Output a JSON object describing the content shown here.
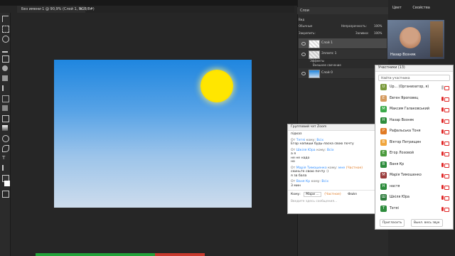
{
  "photoshop": {
    "doc_tab": "Без имени-1 @ 90,9% (Слой 1, RGB/8#)",
    "layers_panel_title": "Слои",
    "blend_mode": "Обычные",
    "opacity_label": "Непрозрачность:",
    "opacity_value": "100%",
    "lock_label": "Закрепить:",
    "fill_label": "Заливка:",
    "fill_value": "100%",
    "layers": [
      {
        "name": "Слой 1"
      },
      {
        "name": "Эллипс 1"
      },
      {
        "name": "Слой 0"
      }
    ],
    "effects_label": "Эффекты",
    "glow_label": "Внешнее свечение",
    "search_kind": "Вид",
    "right_menu": [
      "Цвет",
      "Свойства"
    ]
  },
  "video": {
    "name": "Назар Возняк"
  },
  "chat": {
    "title": "Групповий чат Zoom",
    "top_text": "підказ",
    "messages": [
      {
        "from": "Тетяі",
        "to": "Всіх",
        "text": "Егор напиши будь-ласка свою почту"
      },
      {
        "from": "Шкіля Юра",
        "to": "Всіх",
        "text": "а я\nне не надо\nно"
      },
      {
        "from": "Марія Тимошенко",
        "to": "мне",
        "note": "(Частное)",
        "text": "скиньте свою почту :)\nя за бала"
      },
      {
        "from": "Ваня Кр",
        "to": "Всіх",
        "text": "3 мин"
      }
    ],
    "from_prefix": "От",
    "to_prefix": "кому:",
    "to_label": "Кому:",
    "recipient": "Мари ...",
    "private_note": "(Частное)",
    "file_label": "Файл",
    "input_placeholder": "Введите здесь сообщения..."
  },
  "participants": {
    "title": "Участники (13)",
    "search_placeholder": "Найти участника",
    "list": [
      {
        "initial": "U",
        "name": "Up... (Организатор, я)",
        "color": "#7a9a3c"
      },
      {
        "initial": "Е",
        "name": "Евген Яроповец",
        "color": "#d59a5e"
      },
      {
        "initial": "М",
        "name": "Максим Галаковський",
        "color": "#3cab4a"
      },
      {
        "initial": "Н",
        "name": "Назар Возняк",
        "color": "#2d8c3c"
      },
      {
        "initial": "Р",
        "name": "Рафальська Тоня",
        "color": "#e07a24"
      },
      {
        "initial": "В",
        "name": "Віктор Петрищин",
        "color": "#f0a53c"
      },
      {
        "initial": "Е",
        "name": "Егор Лозовой",
        "color": "#4a9a3c"
      },
      {
        "initial": "В",
        "name": "Ваня Кр",
        "color": "#2d8c3c"
      },
      {
        "initial": "М",
        "name": "Марія Тимошенко",
        "color": "#9a3c3c"
      },
      {
        "initial": "Н",
        "name": "настя",
        "color": "#2d8c3c"
      },
      {
        "initial": "Ш",
        "name": "Шкіля Юра",
        "color": "#2d7c3c"
      },
      {
        "initial": "Т",
        "name": "Тетяі",
        "color": "#2d8c3c"
      }
    ],
    "invite_button": "Пригласить",
    "mute_all_button": "Выкл. весь звук"
  },
  "colors": {
    "accent": "#2d8cff",
    "muted_red": "#e02828"
  }
}
